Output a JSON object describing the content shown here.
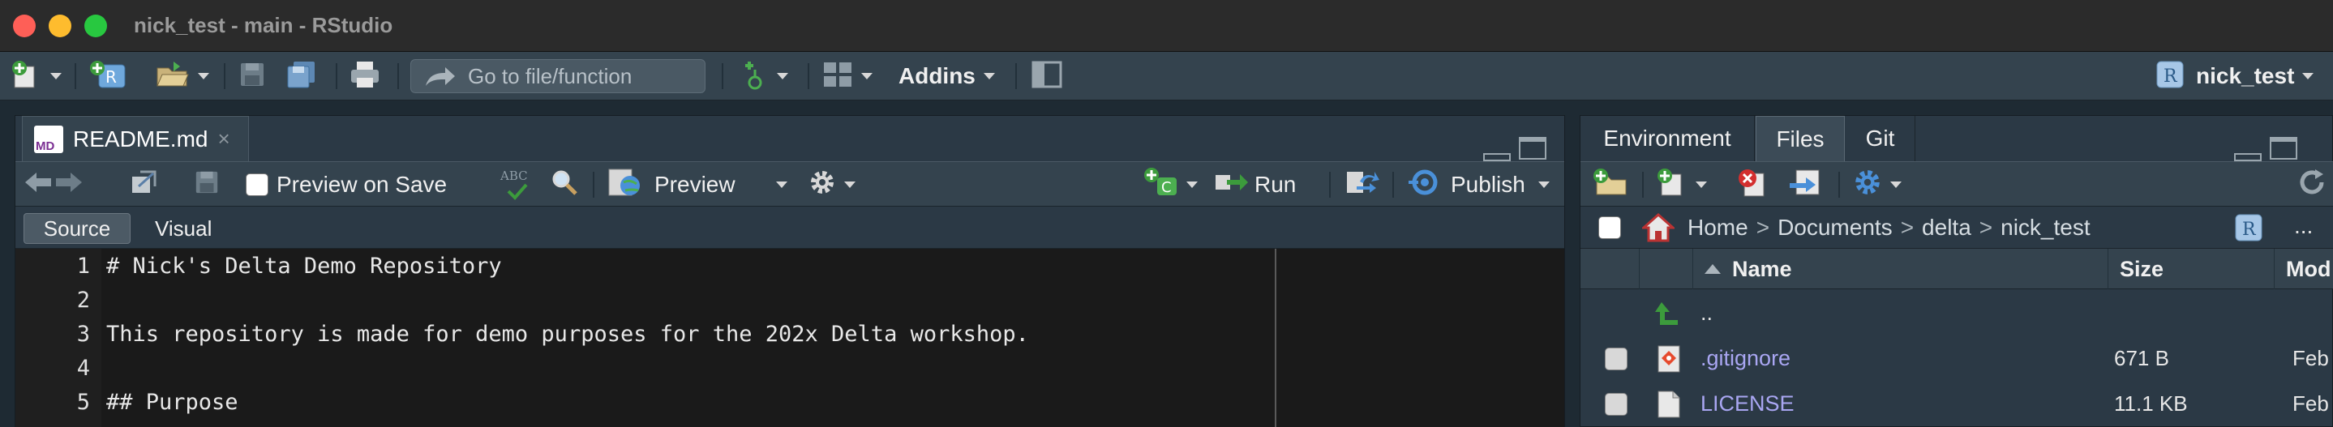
{
  "window": {
    "title": "nick_test - main - RStudio"
  },
  "main_toolbar": {
    "goto_placeholder": "Go to file/function",
    "addins_label": "Addins",
    "project_name": "nick_test"
  },
  "editor": {
    "tab_label": "README.md",
    "tab_close": "×",
    "file_type_badge": "MD",
    "preview_on_save_label": "Preview on Save",
    "preview_label": "Preview",
    "run_label": "Run",
    "publish_label": "Publish",
    "spell_badge": "ABC",
    "mode_source": "Source",
    "mode_visual": "Visual",
    "lines": [
      {
        "n": "1",
        "text": "# Nick's Delta Demo Repository"
      },
      {
        "n": "2",
        "text": ""
      },
      {
        "n": "3",
        "text": "This repository is made for demo purposes for the 202x Delta workshop."
      },
      {
        "n": "4",
        "text": ""
      },
      {
        "n": "5",
        "text": "## Purpose"
      }
    ]
  },
  "right_pane": {
    "tabs": [
      "Environment",
      "Files",
      "Git"
    ],
    "active_tab": "Files",
    "breadcrumb": [
      "Home",
      "Documents",
      "delta",
      "nick_test"
    ],
    "crumb_sep": ">",
    "more": "...",
    "columns": {
      "name": "Name",
      "size": "Size",
      "modified": "Mod"
    },
    "parent_dir": "..",
    "files": [
      {
        "name": ".gitignore",
        "size": "671 B",
        "modified": "Feb"
      },
      {
        "name": "LICENSE",
        "size": "11.1 KB",
        "modified": "Feb"
      }
    ]
  },
  "colors": {
    "toolbar_bg": "#34434e",
    "editor_bg": "#1a1a1a",
    "file_link": "#a9a6f2",
    "accent_green": "#4caf50"
  }
}
